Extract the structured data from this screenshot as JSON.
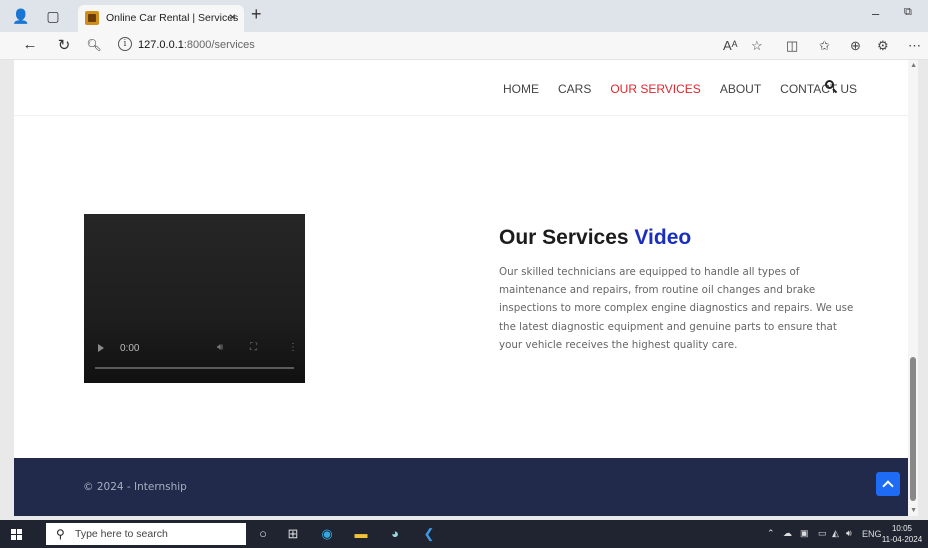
{
  "browser": {
    "tab_title": "Online Car Rental | Services",
    "tab_close": "×",
    "new_tab": "+",
    "url_host": "127.0.0.1",
    "url_path": ":8000/services",
    "info_symbol": "i",
    "window_minimize": "–",
    "window_restore": "🗗"
  },
  "site": {
    "menu": [
      {
        "label": "HOME"
      },
      {
        "label": "CARS"
      },
      {
        "label": "OUR SERVICES"
      },
      {
        "label": "ABOUT"
      },
      {
        "label": "CONTACT US"
      }
    ],
    "active_menu": "OUR SERVICES"
  },
  "video": {
    "time": "0:00"
  },
  "section": {
    "title_main": "Our Services ",
    "title_accent": "Video",
    "description": "Our skilled technicians are equipped to handle all types of maintenance and repairs, from routine oil changes and brake inspections to more complex engine diagnostics and repairs. We use the latest diagnostic equipment and genuine parts to ensure that your vehicle receives the highest quality care."
  },
  "footer": {
    "copyright": "© 2024 - Internship"
  },
  "taskbar": {
    "search_placeholder": "Type here to search",
    "language": "ENG",
    "time": "10:05",
    "date": "11-04-2024"
  },
  "colors": {
    "accent_blue": "#1a2fbf",
    "active_red": "#e0262c",
    "footer_navy": "#212a4a",
    "back_to_top_blue": "#1e6cf5"
  }
}
